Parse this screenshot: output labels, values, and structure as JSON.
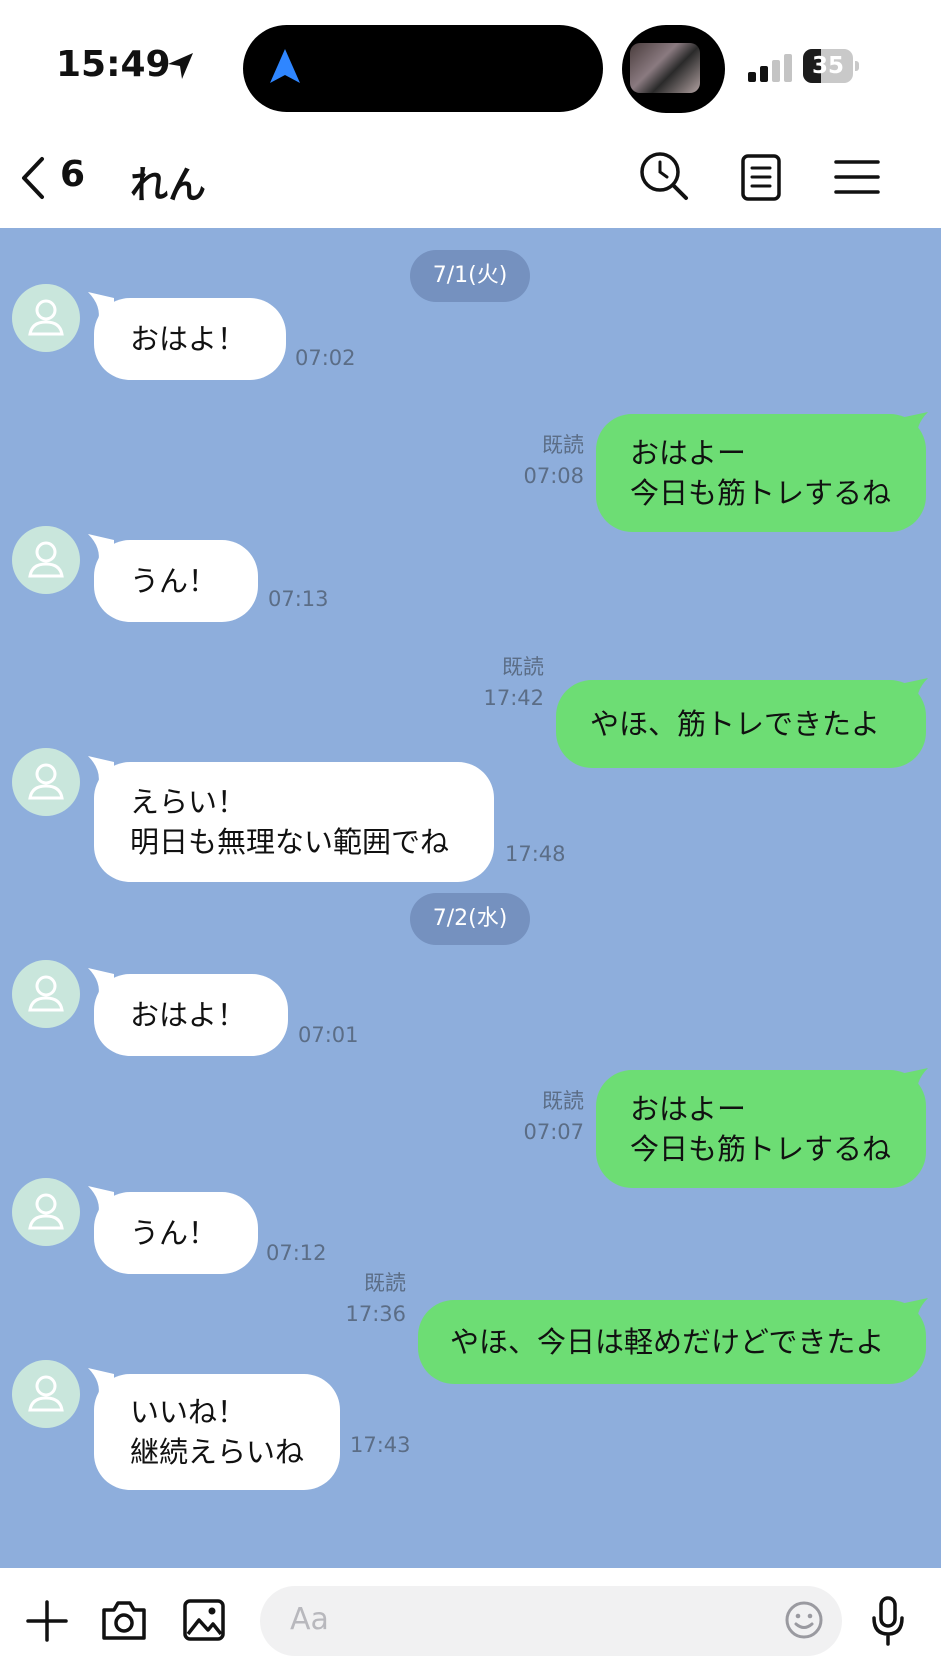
{
  "status_bar": {
    "time": "15:49",
    "battery": "35",
    "battery_level": 0.35,
    "icons": [
      "location-arrow-icon",
      "navigation-icon",
      "signal-icon",
      "battery-icon"
    ]
  },
  "header": {
    "unread_count": "6",
    "contact_name": "れん",
    "icons": [
      "back-chevron-icon",
      "search-icon",
      "notes-icon",
      "menu-icon"
    ]
  },
  "chat": {
    "background": "#8eaedc",
    "outgoing_color": "#6ddd74",
    "date_1": "7/1(火)",
    "date_2": "7/2(水)",
    "m1": {
      "text": "おはよ！",
      "time": "07:02"
    },
    "m2": {
      "text": "おはよー\n今日も筋トレするね",
      "read": "既読",
      "time": "07:08"
    },
    "m3": {
      "text": "うん！",
      "time": "07:13"
    },
    "m4": {
      "text": "やほ、筋トレできたよ",
      "read": "既読",
      "time": "17:42"
    },
    "m5": {
      "text": "えらい！\n明日も無理ない範囲でね",
      "time": "17:48"
    },
    "m6": {
      "text": "おはよ！",
      "time": "07:01"
    },
    "m7": {
      "text": "おはよー\n今日も筋トレするね",
      "read": "既読",
      "time": "07:07"
    },
    "m8": {
      "text": "うん！",
      "time": "07:12"
    },
    "m9": {
      "text": "やほ、今日は軽めだけどできたよ",
      "read": "既読",
      "time": "17:36"
    },
    "m10": {
      "text": "いいね！\n継続えらいね",
      "time": "17:43"
    }
  },
  "input_bar": {
    "placeholder": "Aa",
    "icons": [
      "plus-icon",
      "camera-icon",
      "image-icon",
      "emoji-icon",
      "microphone-icon"
    ]
  }
}
